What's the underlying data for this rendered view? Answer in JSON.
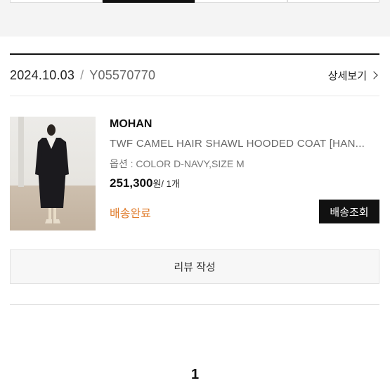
{
  "order": {
    "date": "2024.10.03",
    "separator": "/",
    "number": "Y05570770",
    "detail_link": "상세보기"
  },
  "product": {
    "brand": "MOHAN",
    "name": "TWF CAMEL HAIR SHAWL HOODED COAT [HAN...",
    "option": "옵션 : COLOR D-NAVY,SIZE M",
    "price": "251,300",
    "price_suffix": "원/ 1개",
    "status": "배송완료",
    "status_color": "#e07b2a",
    "track_button": "배송조회"
  },
  "review_button": "리뷰 작성",
  "pagination": {
    "current": "1"
  }
}
